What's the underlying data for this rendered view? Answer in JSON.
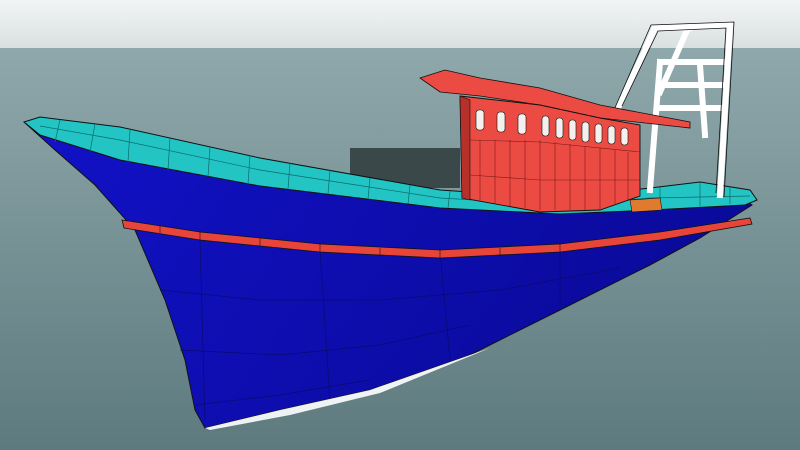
{
  "scene": {
    "subject": "fishing-boat-3d-model",
    "colors": {
      "sky_top": "#f3f5f5",
      "sky_bottom": "#d9e0e0",
      "water_top": "#8fa8ab",
      "water_bottom": "#5d7a7e",
      "hull": "#1212c8",
      "hull_shadow": "#0a0a9a",
      "deck": "#22c4c4",
      "rubbing_strip": "#e8453a",
      "cabin": "#ec4b43",
      "cabin_dark": "#b8302a",
      "cabin_window": "#f4f0ee",
      "mast": "#ffffff",
      "outline": "#111111"
    }
  }
}
